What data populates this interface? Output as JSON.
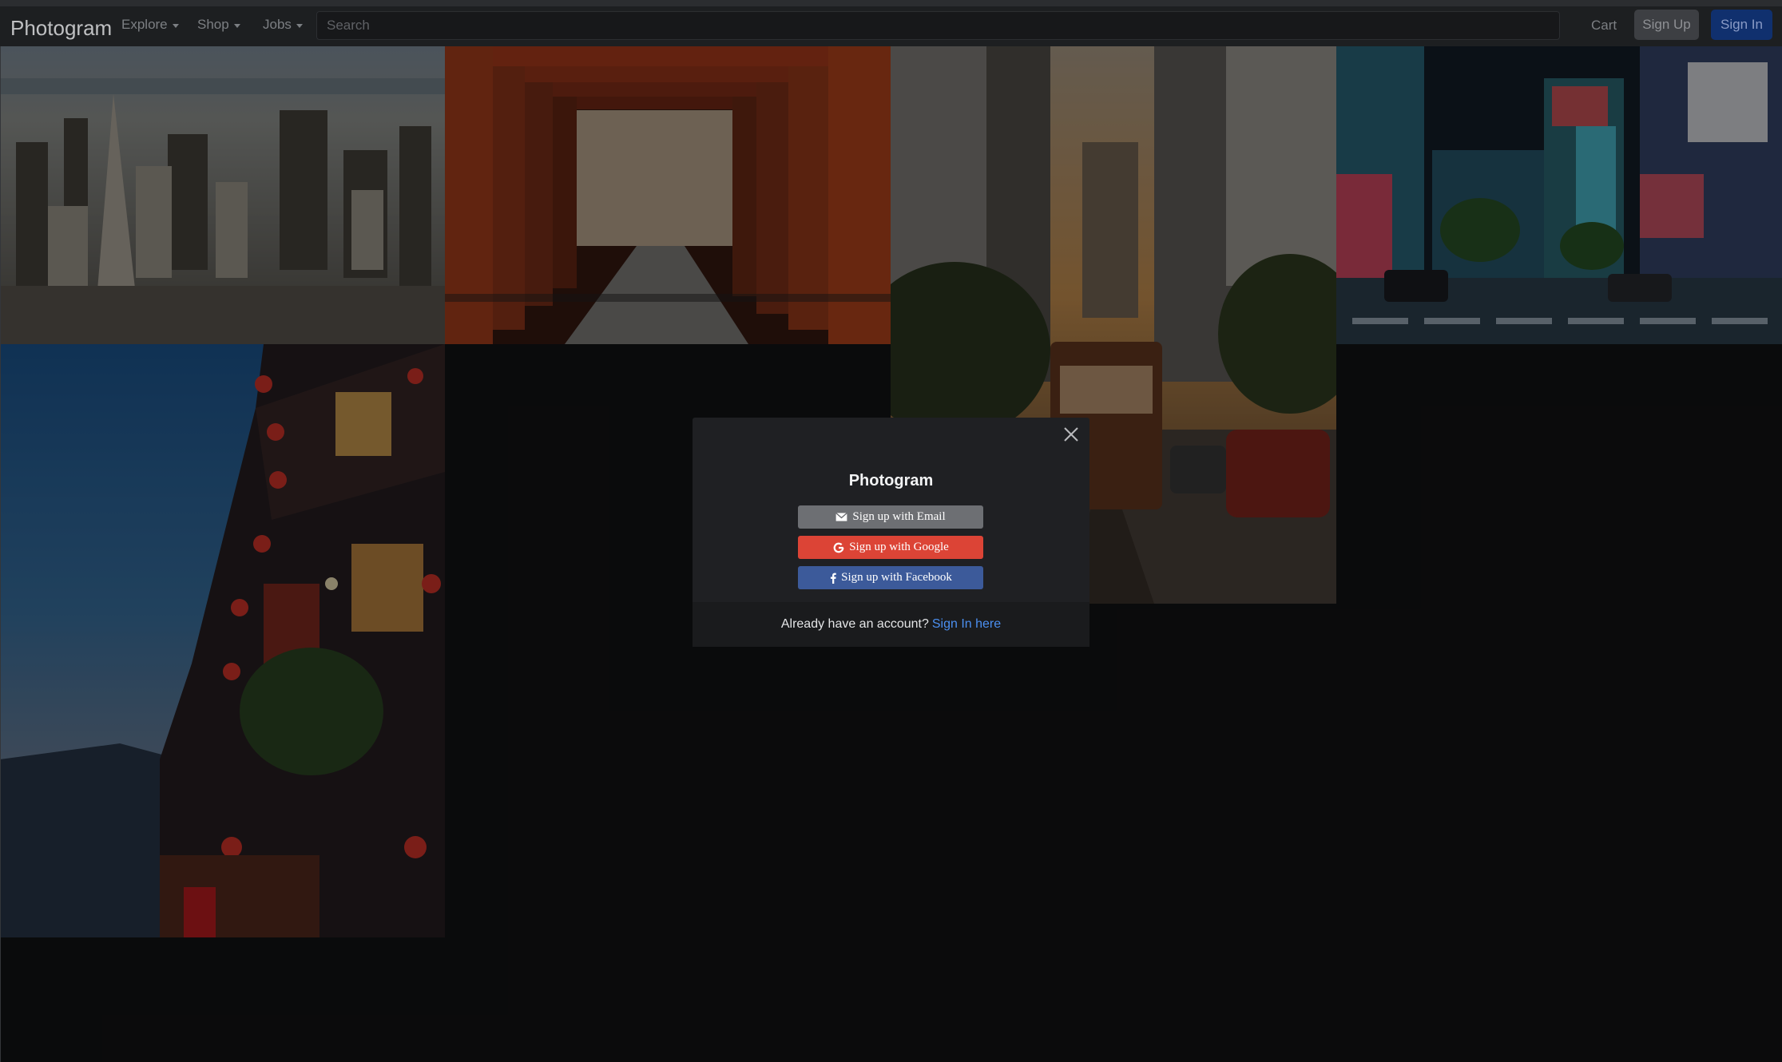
{
  "navbar": {
    "brand": "Photogram",
    "menus": [
      {
        "label": "Explore"
      },
      {
        "label": "Shop"
      },
      {
        "label": "Jobs"
      }
    ],
    "search_placeholder": "Search",
    "cart_label": "Cart",
    "signup_label": "Sign Up",
    "signin_label": "Sign In"
  },
  "gallery": {
    "photos": [
      {
        "subject": "aerial city skyline"
      },
      {
        "subject": "red torii gate tunnel"
      },
      {
        "subject": "city street with cable car"
      },
      {
        "subject": "neon city crosswalk at night"
      },
      {
        "subject": "lantern-lit hillside building at dusk"
      }
    ]
  },
  "modal": {
    "title": "Photogram",
    "email_button": "Sign up with Email",
    "google_button": "Sign up with Google",
    "facebook_button": "Sign up with Facebook",
    "footer_text": "Already have an account?",
    "footer_link": "Sign In here",
    "colors": {
      "email": "#6d6f73",
      "google": "#dc4436",
      "facebook": "#3c5a9a",
      "link": "#4b8ff0"
    }
  }
}
